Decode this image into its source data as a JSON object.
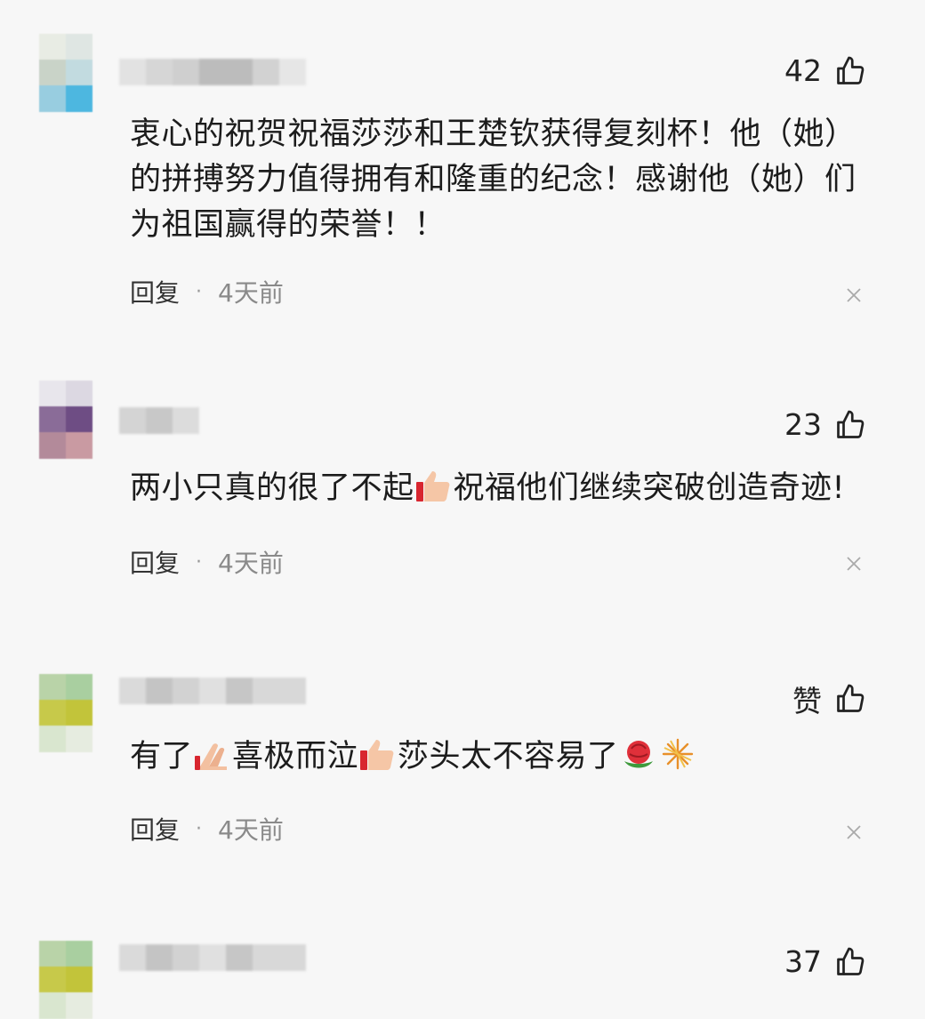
{
  "comments": [
    {
      "likes": "42",
      "text": "衷心的祝贺祝福莎莎和王楚钦获得复刻杯！他（她）的拼搏努力值得拥有和隆重的纪念！感谢他（她）们为祖国赢得的荣誉！！",
      "reply": "回复",
      "time": "4天前"
    },
    {
      "likes": "23",
      "text_a": "两小只真的很了不起",
      "text_b": "祝福他们继续突破创造奇迹!",
      "reply": "回复",
      "time": "4天前"
    },
    {
      "likes": "赞",
      "text_a": "有了",
      "text_b": "喜极而泣",
      "text_c": "莎头太不容易了",
      "reply": "回复",
      "time": "4天前"
    },
    {
      "likes": "37"
    }
  ],
  "icons": {
    "like": "thumbs-up-icon",
    "close": "close-icon",
    "emoji_thumb": "thumbs-up-emoji",
    "emoji_pray": "folded-hands-emoji",
    "emoji_rose": "rose-emoji",
    "emoji_sparkler": "sparkler-emoji"
  }
}
